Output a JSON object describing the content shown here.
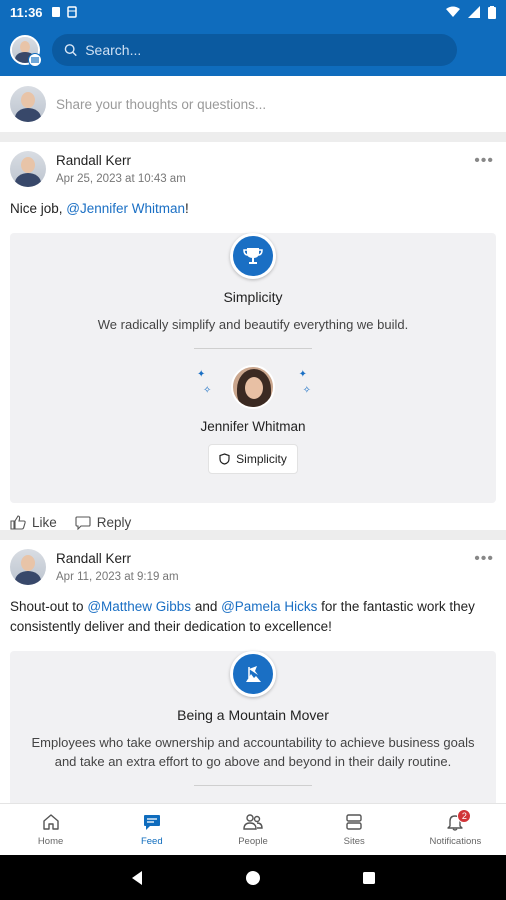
{
  "status_bar": {
    "time": "11:36"
  },
  "search": {
    "placeholder": "Search..."
  },
  "composer": {
    "placeholder": "Share your thoughts or questions..."
  },
  "posts": [
    {
      "author": "Randall Kerr",
      "date": "Apr 25, 2023 at 10:43 am",
      "text_prefix": "Nice job, ",
      "mention": "@Jennifer Whitman",
      "text_suffix": "!",
      "praise": {
        "value_title": "Simplicity",
        "value_description": "We radically simplify and beautify everything we build.",
        "recipient": "Jennifer Whitman",
        "chip_label": "Simplicity"
      },
      "actions": {
        "like": "Like",
        "reply": "Reply"
      }
    },
    {
      "author": "Randall Kerr",
      "date": "Apr 11, 2023 at 9:19 am",
      "text_parts": [
        "Shout-out to ",
        "@Matthew Gibbs",
        " and ",
        "@Pamela Hicks",
        " for the fantastic work they consistently deliver and their dedication to excellence!"
      ],
      "praise": {
        "value_title": "Being a Mountain Mover",
        "value_description": "Employees who take ownership and accountability to achieve business goals and take an extra effort to go above and beyond in their daily routine."
      }
    }
  ],
  "bottom_nav": {
    "items": [
      {
        "label": "Home",
        "icon": "home-icon"
      },
      {
        "label": "Feed",
        "icon": "feed-icon",
        "active": true
      },
      {
        "label": "People",
        "icon": "people-icon"
      },
      {
        "label": "Sites",
        "icon": "sites-icon"
      },
      {
        "label": "Notifications",
        "icon": "bell-icon",
        "badge": "2"
      }
    ]
  },
  "colors": {
    "brand": "#0f6cbd",
    "mention": "#1a6fc4",
    "badge": "#d13438"
  }
}
